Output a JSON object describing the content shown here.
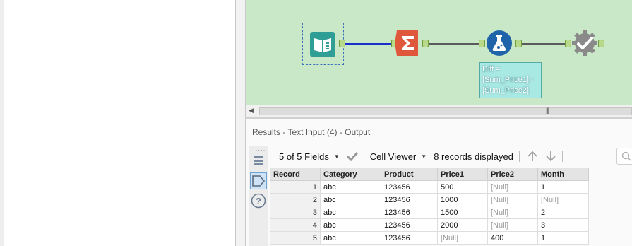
{
  "canvas": {
    "tools": [
      {
        "name": "text-input-tool",
        "icon": "book-icon"
      },
      {
        "name": "summarize-tool",
        "icon": "sigma-icon"
      },
      {
        "name": "formula-tool",
        "icon": "flask-icon"
      },
      {
        "name": "test-tool",
        "icon": "checkmark-gear-icon"
      }
    ],
    "tooltip": {
      "line1": "Diff =",
      "line2": "[Sum_Price1] -",
      "line3": "[Sum_Price2]"
    },
    "colors": {
      "canvas_bg": "#c8e8c8",
      "selected_connection": "#1a2ecc",
      "connection": "#555555"
    }
  },
  "scrollbar": {
    "grip": "|||"
  },
  "results": {
    "title": "Results - Text Input (4) - Output",
    "toolbar": {
      "fields_label": "5 of 5 Fields",
      "cell_viewer_label": "Cell Viewer",
      "records_label": "8 records displayed"
    },
    "columns": [
      "Record",
      "Category",
      "Product",
      "Price1",
      "Price2",
      "Month"
    ],
    "rows": [
      {
        "record": "1",
        "category": "abc",
        "product": "123456",
        "price1": "500",
        "price2": "[Null]",
        "month": "1"
      },
      {
        "record": "2",
        "category": "abc",
        "product": "123456",
        "price1": "1000",
        "price2": "[Null]",
        "month": "[Null]"
      },
      {
        "record": "3",
        "category": "abc",
        "product": "123456",
        "price1": "1500",
        "price2": "[Null]",
        "month": "2"
      },
      {
        "record": "4",
        "category": "abc",
        "product": "123456",
        "price1": "2000",
        "price2": "[Null]",
        "month": "3"
      },
      {
        "record": "5",
        "category": "abc",
        "product": "123456",
        "price1": "[Null]",
        "price2": "400",
        "month": "1"
      }
    ]
  }
}
